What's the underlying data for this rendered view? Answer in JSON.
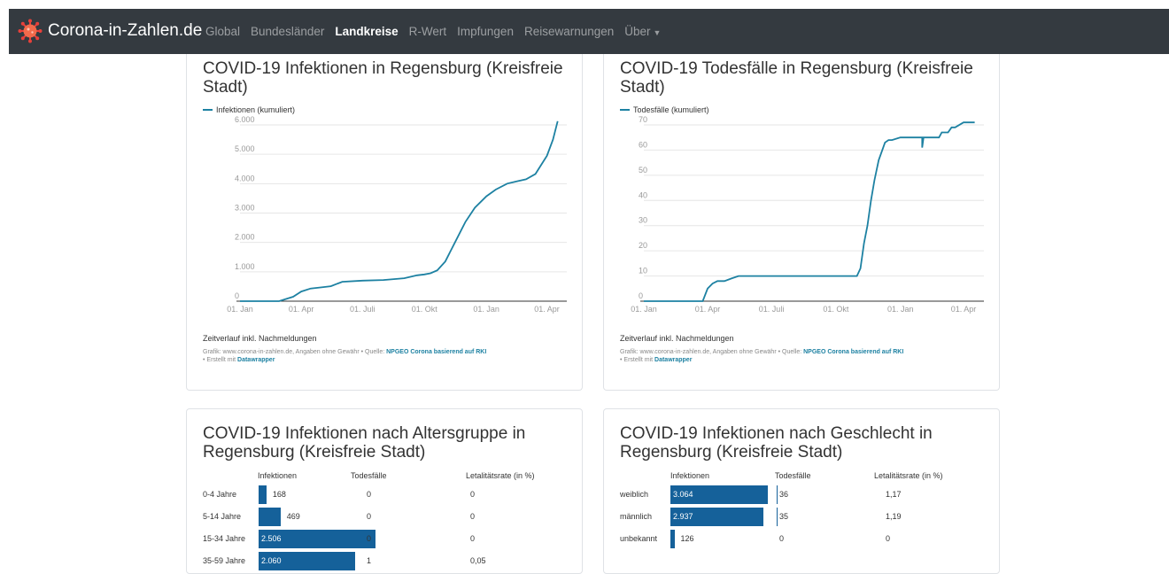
{
  "nav": {
    "brand": "Corona-in-Zahlen.de",
    "items": [
      {
        "label": "Global",
        "active": false
      },
      {
        "label": "Bundesländer",
        "active": false
      },
      {
        "label": "Landkreise",
        "active": true
      },
      {
        "label": "R-Wert",
        "active": false
      },
      {
        "label": "Impfungen",
        "active": false
      },
      {
        "label": "Reisewarnungen",
        "active": false
      },
      {
        "label": "Über",
        "active": false
      }
    ]
  },
  "card_infections": {
    "title": "COVID-19 Infektionen in Regensburg (Kreisfreie Stadt)",
    "legend": "Infektionen (kumuliert)",
    "note": "Zeitverlauf inkl. Nachmeldungen",
    "credit_prefix": "Grafik: www.corona-in-zahlen.de, Angaben ohne Gewähr • Quelle: ",
    "credit_source": "NPGEO Corona basierend auf RKI",
    "credit_mid": " • Erstellt mit ",
    "credit_tool": "Datawrapper"
  },
  "card_deaths": {
    "title": "COVID-19 Todesfälle in Regensburg (Kreisfreie Stadt)",
    "legend": "Todesfälle (kumuliert)",
    "note": "Zeitverlauf inkl. Nachmeldungen",
    "credit_prefix": "Grafik: www.corona-in-zahlen.de, Angaben ohne Gewähr • Quelle: ",
    "credit_source": "NPGEO Corona basierend auf RKI",
    "credit_mid": " • Erstellt mit ",
    "credit_tool": "Datawrapper"
  },
  "card_age": {
    "title": "COVID-19 Infektionen nach Altersgruppe in Regensburg (Kreisfreie Stadt)",
    "headers": [
      "Infektionen",
      "Todesfälle",
      "Letalitätsrate (in %)"
    ],
    "rows": [
      {
        "label": "0-4 Jahre",
        "infections": "168",
        "deaths": "0",
        "rate": "0"
      },
      {
        "label": "5-14 Jahre",
        "infections": "469",
        "deaths": "0",
        "rate": "0"
      },
      {
        "label": "15-34 Jahre",
        "infections": "2.506",
        "deaths": "0",
        "rate": "0"
      },
      {
        "label": "35-59 Jahre",
        "infections": "2.060",
        "deaths": "1",
        "rate": "0,05"
      }
    ]
  },
  "card_gender": {
    "title": "COVID-19 Infektionen nach Geschlecht in Regensburg (Kreisfreie Stadt)",
    "headers": [
      "Infektionen",
      "Todesfälle",
      "Letalitätsrate (in %)"
    ],
    "rows": [
      {
        "label": "weiblich",
        "infections": "3.064",
        "deaths": "36",
        "rate": "1,17"
      },
      {
        "label": "männlich",
        "infections": "2.937",
        "deaths": "35",
        "rate": "1,19"
      },
      {
        "label": "unbekannt",
        "infections": "126",
        "deaths": "0",
        "rate": "0"
      }
    ]
  },
  "colors": {
    "line": "#1d81a2",
    "bar": "#15619a",
    "navbar": "#343a40",
    "virus": "#e8403a"
  },
  "chart_data": [
    {
      "type": "line",
      "series": [
        {
          "name": "Infektionen (kumuliert)",
          "x": [
            "2020-01-01",
            "2020-02-28",
            "2020-03-20",
            "2020-04-01",
            "2020-04-15",
            "2020-05-01",
            "2020-05-15",
            "2020-06-01",
            "2020-07-01",
            "2020-08-01",
            "2020-09-01",
            "2020-09-20",
            "2020-10-01",
            "2020-10-10",
            "2020-10-20",
            "2020-11-01",
            "2020-11-15",
            "2020-12-01",
            "2020-12-15",
            "2021-01-01",
            "2021-01-15",
            "2021-02-01",
            "2021-02-15",
            "2021-03-01",
            "2021-03-15",
            "2021-04-01",
            "2021-04-10",
            "2021-04-17"
          ],
          "y": [
            0,
            0,
            150,
            330,
            430,
            470,
            510,
            660,
            700,
            720,
            780,
            880,
            910,
            950,
            1050,
            1350,
            1980,
            2700,
            3180,
            3570,
            3800,
            4000,
            4080,
            4150,
            4330,
            4950,
            5500,
            6127
          ]
        }
      ],
      "x_ticks": [
        "01. Jan",
        "01. Apr",
        "01. Juli",
        "01. Okt",
        "01. Jan",
        "01. Apr"
      ],
      "y_ticks": [
        "0",
        "1.000",
        "2.000",
        "3.000",
        "4.000",
        "5.000",
        "6.000"
      ],
      "ylim": [
        0,
        6000
      ]
    },
    {
      "type": "line",
      "series": [
        {
          "name": "Todesfälle (kumuliert)",
          "x": [
            "2020-01-01",
            "2020-03-25",
            "2020-04-01",
            "2020-04-08",
            "2020-04-15",
            "2020-04-25",
            "2020-05-05",
            "2020-05-15",
            "2020-10-31",
            "2020-11-05",
            "2020-11-10",
            "2020-11-15",
            "2020-11-20",
            "2020-11-25",
            "2020-12-01",
            "2020-12-10",
            "2020-12-15",
            "2020-12-20",
            "2021-01-01",
            "2021-01-15",
            "2021-02-01",
            "2021-02-01",
            "2021-02-03",
            "2021-02-25",
            "2021-03-01",
            "2021-03-10",
            "2021-03-15",
            "2021-03-20",
            "2021-04-01",
            "2021-04-17"
          ],
          "y": [
            0,
            0,
            5,
            7,
            8,
            8,
            9,
            10,
            10,
            13,
            23,
            30,
            40,
            48,
            56,
            63,
            64,
            64,
            65,
            65,
            65,
            61,
            65,
            65,
            67,
            67,
            69,
            69,
            71,
            71
          ]
        }
      ],
      "x_ticks": [
        "01. Jan",
        "01. Apr",
        "01. Juli",
        "01. Okt",
        "01. Jan",
        "01. Apr"
      ],
      "y_ticks": [
        "0",
        "10",
        "20",
        "30",
        "40",
        "50",
        "60",
        "70"
      ],
      "ylim": [
        0,
        70
      ]
    },
    {
      "type": "bar",
      "categories": [
        "0-4 Jahre",
        "5-14 Jahre",
        "15-34 Jahre",
        "35-59 Jahre"
      ],
      "series": [
        {
          "name": "Infektionen",
          "values": [
            168,
            469,
            2506,
            2060
          ]
        },
        {
          "name": "Todesfälle",
          "values": [
            0,
            0,
            0,
            1
          ]
        },
        {
          "name": "Letalitätsrate (in %)",
          "values": [
            0,
            0,
            0,
            0.05
          ]
        }
      ]
    },
    {
      "type": "bar",
      "categories": [
        "weiblich",
        "männlich",
        "unbekannt"
      ],
      "series": [
        {
          "name": "Infektionen",
          "values": [
            3064,
            2937,
            126
          ]
        },
        {
          "name": "Todesfälle",
          "values": [
            36,
            35,
            0
          ]
        },
        {
          "name": "Letalitätsrate (in %)",
          "values": [
            1.17,
            1.19,
            0
          ]
        }
      ]
    }
  ]
}
